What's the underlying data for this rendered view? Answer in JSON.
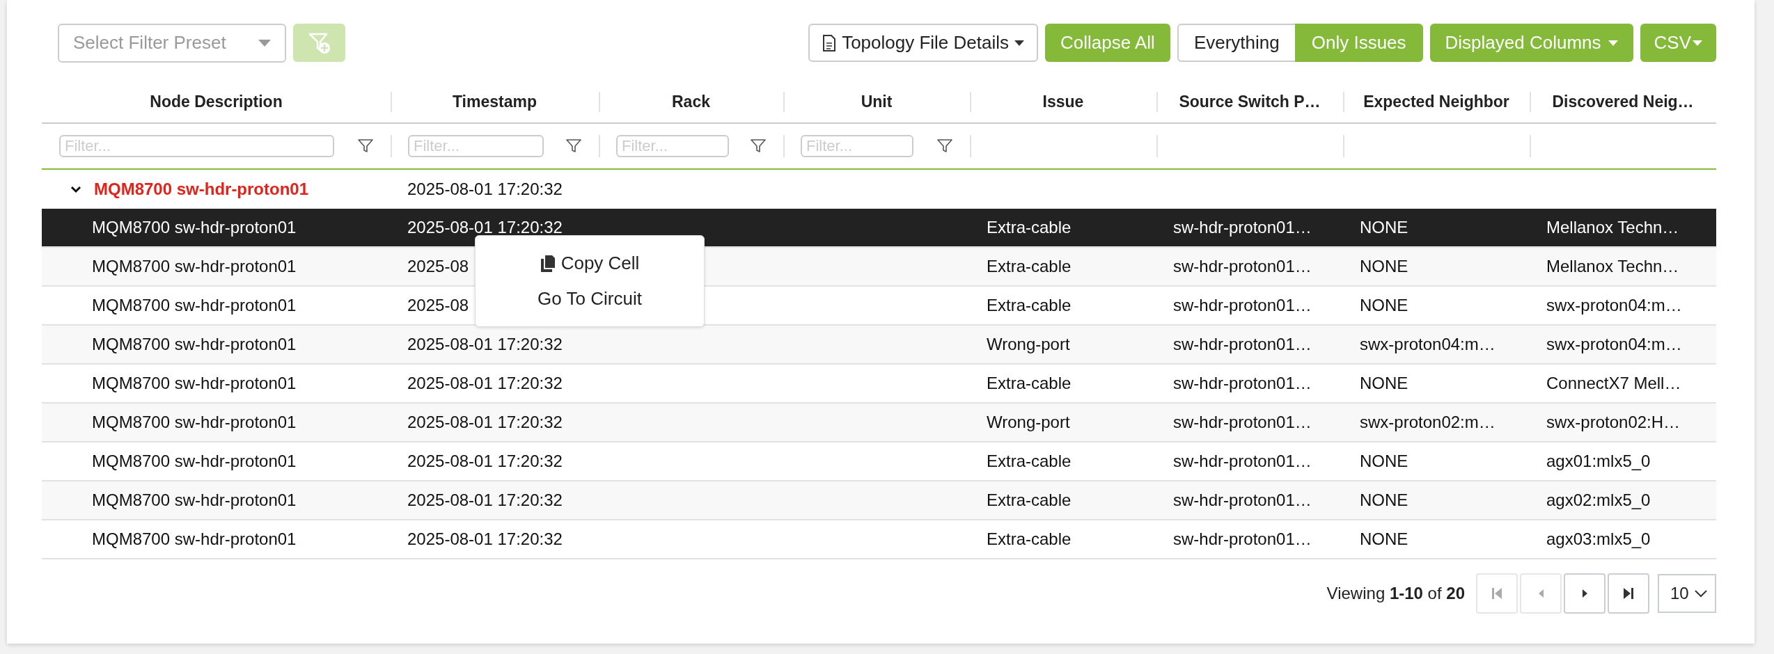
{
  "toolbar": {
    "filter_preset": {
      "placeholder": "Select Filter Preset"
    },
    "add_filter_button": {
      "disabled": true
    },
    "topology_button": {
      "label": "Topology File Details"
    },
    "collapse_button": {
      "label": "Collapse All"
    },
    "view_toggle": [
      {
        "label": "Everything",
        "selected": false
      },
      {
        "label": "Only Issues",
        "selected": true
      }
    ],
    "columns_button": {
      "label": "Displayed Columns"
    },
    "csv_button": {
      "label": "CSV"
    }
  },
  "table": {
    "columns": [
      {
        "label": "Node Description",
        "filter": {
          "placeholder": "Filter..."
        }
      },
      {
        "label": "Timestamp",
        "filter": {
          "placeholder": "Filter..."
        }
      },
      {
        "label": "Rack",
        "filter": {
          "placeholder": "Filter..."
        }
      },
      {
        "label": "Unit",
        "filter": {
          "placeholder": "Filter..."
        }
      },
      {
        "label": "Issue"
      },
      {
        "label": "Source Switch P…"
      },
      {
        "label": "Expected Neighbor"
      },
      {
        "label": "Discovered Neig…"
      }
    ],
    "groups": [
      {
        "label": "MQM8700 sw-hdr-proton01",
        "timestamp": "2025-08-01 17:20:32",
        "expanded": true,
        "rows": [
          {
            "selected": true,
            "node": "MQM8700 sw-hdr-proton01",
            "timestamp": "2025-08-01 17:20:32",
            "issue": "Extra-cable",
            "source_switch_port": "sw-hdr-proton01…",
            "expected_neighbor": "NONE",
            "discovered_neighbor": "Mellanox Techn…"
          },
          {
            "selected": false,
            "node": "MQM8700 sw-hdr-proton01",
            "timestamp": "2025-08",
            "issue": "Extra-cable",
            "source_switch_port": "sw-hdr-proton01…",
            "expected_neighbor": "NONE",
            "discovered_neighbor": "Mellanox Techn…"
          },
          {
            "selected": false,
            "node": "MQM8700 sw-hdr-proton01",
            "timestamp": "2025-08",
            "issue": "Extra-cable",
            "source_switch_port": "sw-hdr-proton01…",
            "expected_neighbor": "NONE",
            "discovered_neighbor": "swx-proton04:m…"
          },
          {
            "selected": false,
            "node": "MQM8700 sw-hdr-proton01",
            "timestamp": "2025-08-01 17:20:32",
            "issue": "Wrong-port",
            "source_switch_port": "sw-hdr-proton01…",
            "expected_neighbor": "swx-proton04:m…",
            "discovered_neighbor": "swx-proton04:m…"
          },
          {
            "selected": false,
            "node": "MQM8700 sw-hdr-proton01",
            "timestamp": "2025-08-01 17:20:32",
            "issue": "Extra-cable",
            "source_switch_port": "sw-hdr-proton01…",
            "expected_neighbor": "NONE",
            "discovered_neighbor": "ConnectX7 Mell…"
          },
          {
            "selected": false,
            "node": "MQM8700 sw-hdr-proton01",
            "timestamp": "2025-08-01 17:20:32",
            "issue": "Wrong-port",
            "source_switch_port": "sw-hdr-proton01…",
            "expected_neighbor": "swx-proton02:m…",
            "discovered_neighbor": "swx-proton02:H…"
          },
          {
            "selected": false,
            "node": "MQM8700 sw-hdr-proton01",
            "timestamp": "2025-08-01 17:20:32",
            "issue": "Extra-cable",
            "source_switch_port": "sw-hdr-proton01…",
            "expected_neighbor": "NONE",
            "discovered_neighbor": "agx01:mlx5_0"
          },
          {
            "selected": false,
            "node": "MQM8700 sw-hdr-proton01",
            "timestamp": "2025-08-01 17:20:32",
            "issue": "Extra-cable",
            "source_switch_port": "sw-hdr-proton01…",
            "expected_neighbor": "NONE",
            "discovered_neighbor": "agx02:mlx5_0"
          },
          {
            "selected": false,
            "node": "MQM8700 sw-hdr-proton01",
            "timestamp": "2025-08-01 17:20:32",
            "issue": "Extra-cable",
            "source_switch_port": "sw-hdr-proton01…",
            "expected_neighbor": "NONE",
            "discovered_neighbor": "agx03:mlx5_0"
          }
        ]
      }
    ]
  },
  "context_menu": {
    "items": [
      {
        "label": "Copy Cell",
        "kind": "copy"
      },
      {
        "label": "Go To Circuit",
        "kind": "plain"
      }
    ]
  },
  "pagination": {
    "summary": "Viewing **1-10** of **20**",
    "buttons": [
      {
        "kind": "first",
        "disabled": true
      },
      {
        "kind": "prev",
        "disabled": true
      },
      {
        "kind": "next",
        "disabled": false
      },
      {
        "kind": "last",
        "disabled": false
      }
    ],
    "page_size": "10"
  }
}
